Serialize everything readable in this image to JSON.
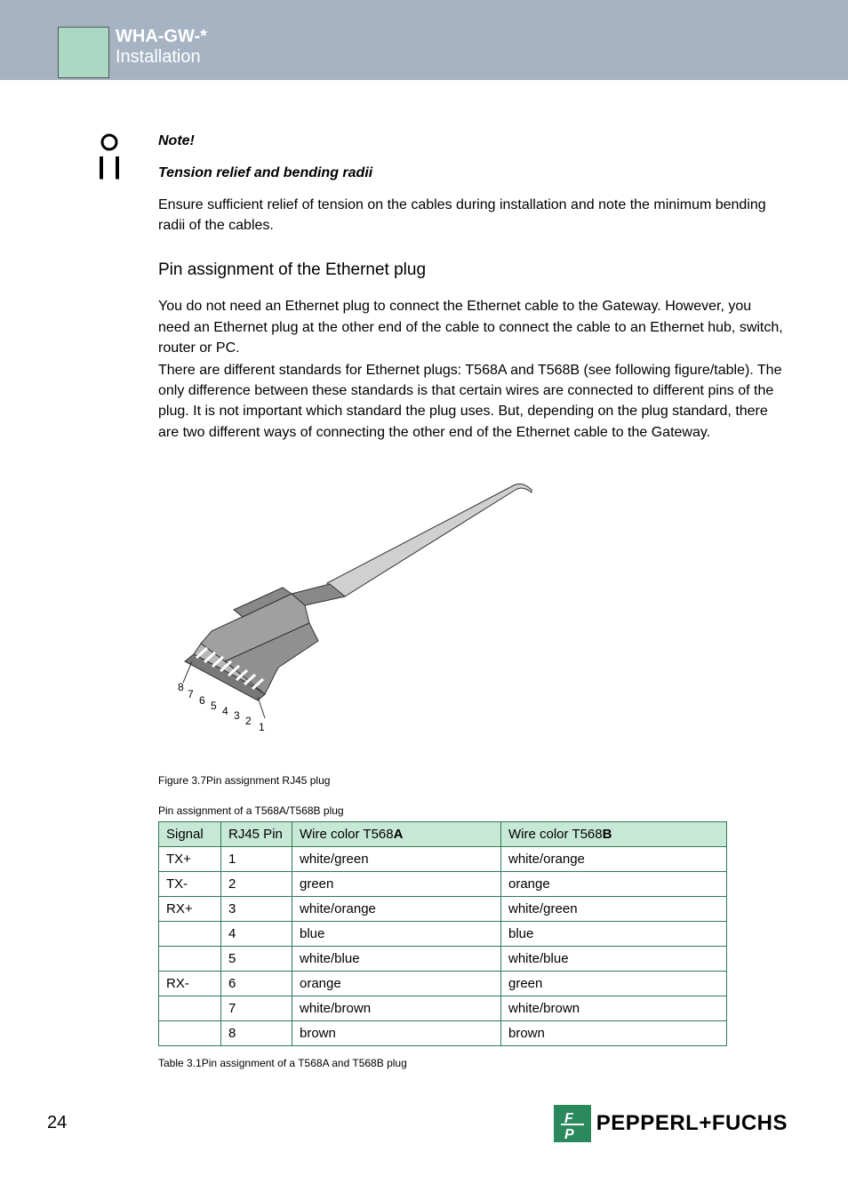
{
  "header": {
    "model": "WHA-GW-*",
    "section": "Installation"
  },
  "note": {
    "title": "Note!",
    "subtitle": "Tension relief and bending radii",
    "text": "Ensure sufficient relief of tension on the cables during installation and note the minimum bending radii of the cables."
  },
  "ethernet": {
    "heading": "Pin assignment of the Ethernet plug",
    "para1": "You do not need an Ethernet plug to connect the Ethernet cable to the Gateway. However, you need an Ethernet plug at the other end of the cable to connect the cable to an Ethernet hub, switch, router or PC.",
    "para2": "There are different standards for Ethernet plugs: T568A and T568B (see following figure/table). The only difference between these standards is that certain wires are connected to different pins of the plug. It is not important which standard the plug uses. But, depending on the plug standard, there are two different ways of connecting the other end of the Ethernet cable to the Gateway."
  },
  "figure_caption_prefix": "Figure 3.7",
  "figure_caption": "Pin assignment RJ45 plug",
  "pin_labels": [
    "8",
    "7",
    "6",
    "5",
    "4",
    "3",
    "2",
    "1"
  ],
  "table_title": "Pin assignment of a T568A/T568B plug",
  "table_headers": {
    "signal": "Signal",
    "rj45": "RJ45 Pin",
    "colA_pre": "Wire color T568",
    "colA_bold": "A",
    "colB_pre": "Wire color T568",
    "colB_bold": "B"
  },
  "rows": [
    {
      "signal": "TX+",
      "pin": "1",
      "a": "white/green",
      "b": "white/orange"
    },
    {
      "signal": "TX-",
      "pin": "2",
      "a": "green",
      "b": "orange"
    },
    {
      "signal": "RX+",
      "pin": "3",
      "a": "white/orange",
      "b": "white/green"
    },
    {
      "signal": "",
      "pin": "4",
      "a": "blue",
      "b": "blue"
    },
    {
      "signal": "",
      "pin": "5",
      "a": "white/blue",
      "b": "white/blue"
    },
    {
      "signal": "RX-",
      "pin": "6",
      "a": "orange",
      "b": "green"
    },
    {
      "signal": "",
      "pin": "7",
      "a": "white/brown",
      "b": "white/brown"
    },
    {
      "signal": "",
      "pin": "8",
      "a": "brown",
      "b": "brown"
    }
  ],
  "table_caption_prefix": "Table 3.1",
  "table_caption": "Pin assignment of a T568A and T568B plug",
  "page_number": "24",
  "footer_brand": "PEPPERL+FUCHS"
}
